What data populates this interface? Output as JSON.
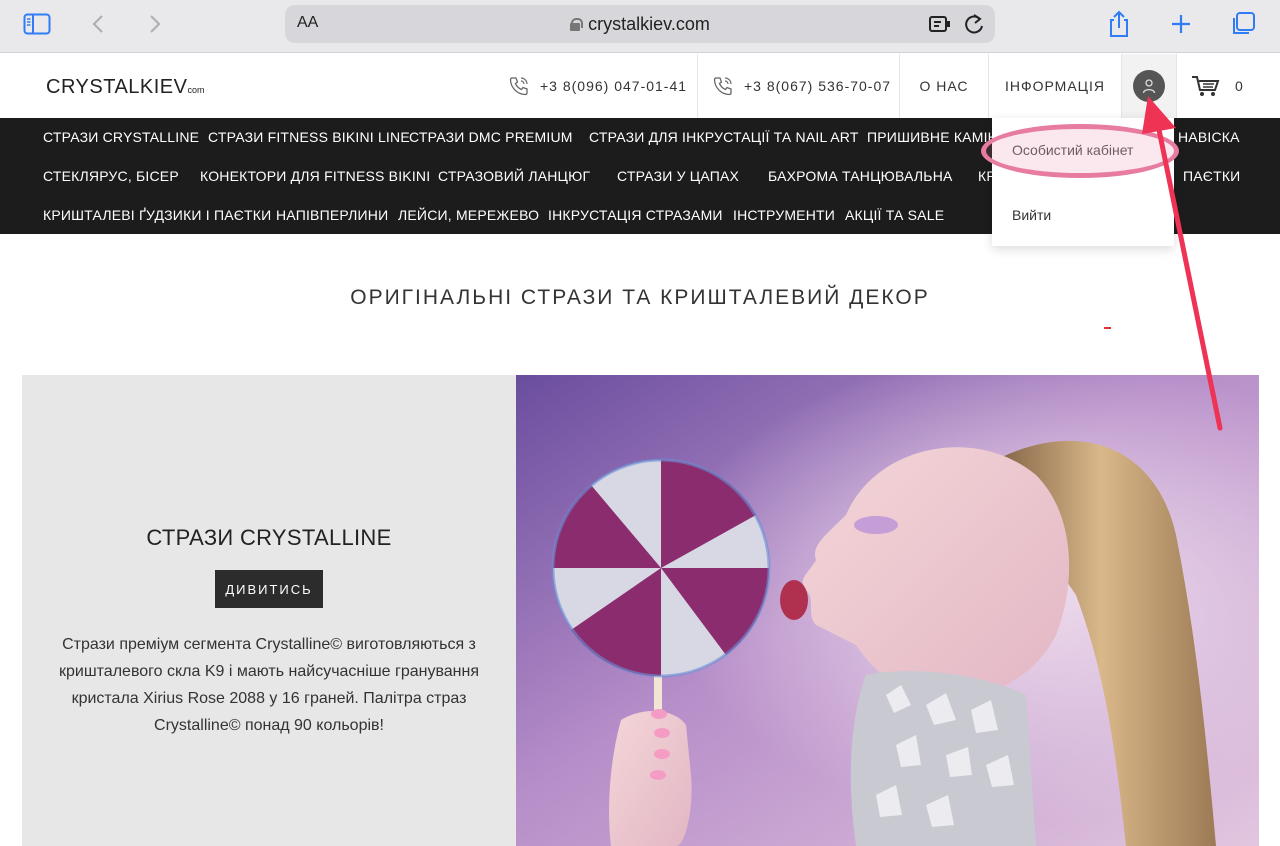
{
  "browser": {
    "url": "crystalkiev.com",
    "text_size_label": "AA"
  },
  "header": {
    "logo_main": "CRYSTALKIEV",
    "logo_suffix": "com",
    "phone1": "+3 8(096) 047-01-41",
    "phone2": "+3 8(067) 536-70-07",
    "about": "О НАС",
    "info": "ІНФОРМАЦІЯ",
    "cart_count": "0"
  },
  "nav": {
    "row1": [
      "СТРАЗИ CRYSTALLINE",
      "СТРАЗИ FITNESS BIKINI LINE",
      "СТРАЗИ DMC PREMIUM",
      "СТРАЗИ ДЛЯ ІНКРУСТАЦІЇ ТА NAIL ART",
      "ПРИШИВНЕ КАМІНН",
      "НАВІСКА"
    ],
    "row2": [
      "СТЕКЛЯРУС, БІСЕР",
      "КОНЕКТОРИ ДЛЯ FITNESS BIKINI",
      "СТРАЗОВИЙ ЛАНЦЮГ",
      "СТРАЗИ У ЦАПАХ",
      "БАХРОМА ТАНЦЮВАЛЬНА",
      "КР",
      "ПАЄТКИ"
    ],
    "row3": [
      "КРИШТАЛЕВІ ҐУДЗИКИ І ПАЄТКИ",
      "НАПІВПЕРЛИНИ",
      "ЛЕЙСИ, МЕРЕЖЕВО",
      "ІНКРУСТАЦІЯ СТРАЗАМИ",
      "ІНСТРУМЕНТИ",
      "АКЦІЇ ТА SALE"
    ]
  },
  "user_menu": {
    "cabinet": "Особистий кабінет",
    "logout": "Вийти"
  },
  "main": {
    "heading": "ОРИГІНАЛЬНІ СТРАЗИ ТА КРИШТАЛЕВИЙ ДЕКОР",
    "banner_title": "СТРАЗИ CRYSTALLINE",
    "banner_button": "ДИВИТИСЬ",
    "banner_text": "Стрази преміум сегмента Crystalline© виготовляються з кришталевого скла K9 і мають найсучасніше гранування кристала Xirius Rose 2088 у 16 граней. Палітра страз Crystalline© понад 90 кольорів!"
  },
  "colors": {
    "nav_bg": "#1c1c1c",
    "browser_accent": "#2f7cf6",
    "annotation_pink": "#e87ba0",
    "annotation_red": "#ee3355"
  }
}
